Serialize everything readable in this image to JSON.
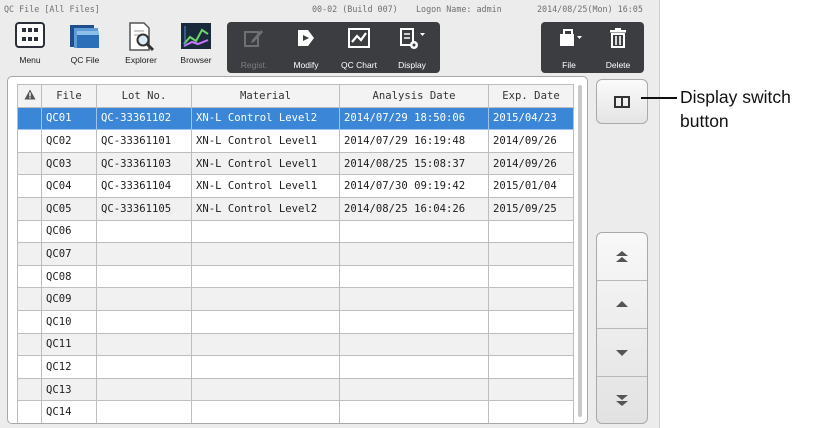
{
  "status": {
    "title": "QC File [All Files]",
    "build": "00-02 (Build 007)",
    "logon": "Logon Name: admin",
    "datetime": "2014/08/25(Mon) 16:05"
  },
  "toolbar": {
    "menu": {
      "label": "Menu",
      "icon": "menu-grid-icon"
    },
    "qcfile": {
      "label": "QC File",
      "icon": "qc-file-icon"
    },
    "explorer": {
      "label": "Explorer",
      "icon": "explorer-icon"
    },
    "browser": {
      "label": "Browser",
      "icon": "browser-icon"
    },
    "regist": {
      "label": "Regist.",
      "icon": "regist-icon",
      "disabled": true
    },
    "modify": {
      "label": "Modify",
      "icon": "modify-icon"
    },
    "qcchart": {
      "label": "QC Chart",
      "icon": "qc-chart-icon"
    },
    "display": {
      "label": "Display",
      "icon": "display-icon"
    },
    "file": {
      "label": "File",
      "icon": "file-icon"
    },
    "delete": {
      "label": "Delete",
      "icon": "trash-icon"
    }
  },
  "table": {
    "headers": [
      "File",
      "Lot No.",
      "Material",
      "Analysis Date",
      "Exp. Date"
    ],
    "rows": [
      {
        "file": "QC01",
        "lot": "QC-33361102",
        "material": "XN-L Control Level2",
        "analysis": "2014/07/29 18:50:06",
        "exp": "2015/04/23"
      },
      {
        "file": "QC02",
        "lot": "QC-33361101",
        "material": "XN-L Control Level1",
        "analysis": "2014/07/29 16:19:48",
        "exp": "2014/09/26"
      },
      {
        "file": "QC03",
        "lot": "QC-33361103",
        "material": "XN-L Control Level1",
        "analysis": "2014/08/25 15:08:37",
        "exp": "2014/09/26"
      },
      {
        "file": "QC04",
        "lot": "QC-33361104",
        "material": "XN-L Control Level1",
        "analysis": "2014/07/30 09:19:42",
        "exp": "2015/01/04"
      },
      {
        "file": "QC05",
        "lot": "QC-33361105",
        "material": "XN-L Control Level2",
        "analysis": "2014/08/25 16:04:26",
        "exp": "2015/09/25"
      },
      {
        "file": "QC06",
        "lot": "",
        "material": "",
        "analysis": "",
        "exp": ""
      },
      {
        "file": "QC07",
        "lot": "",
        "material": "",
        "analysis": "",
        "exp": ""
      },
      {
        "file": "QC08",
        "lot": "",
        "material": "",
        "analysis": "",
        "exp": ""
      },
      {
        "file": "QC09",
        "lot": "",
        "material": "",
        "analysis": "",
        "exp": ""
      },
      {
        "file": "QC10",
        "lot": "",
        "material": "",
        "analysis": "",
        "exp": ""
      },
      {
        "file": "QC11",
        "lot": "",
        "material": "",
        "analysis": "",
        "exp": ""
      },
      {
        "file": "QC12",
        "lot": "",
        "material": "",
        "analysis": "",
        "exp": ""
      },
      {
        "file": "QC13",
        "lot": "",
        "material": "",
        "analysis": "",
        "exp": ""
      },
      {
        "file": "QC14",
        "lot": "",
        "material": "",
        "analysis": "",
        "exp": ""
      }
    ],
    "selected_file": "QC01"
  },
  "side": {
    "display_switch_icon": "display-switch-icon",
    "nav": [
      "scroll-top-icon",
      "scroll-up-icon",
      "scroll-down-icon",
      "scroll-bottom-icon"
    ]
  },
  "callout": {
    "line1": "Display switch",
    "line2": "button"
  },
  "colors": {
    "selection": "#3b86d6",
    "toolbar_dark": "#3b3d40",
    "warning_header": "#555555"
  }
}
